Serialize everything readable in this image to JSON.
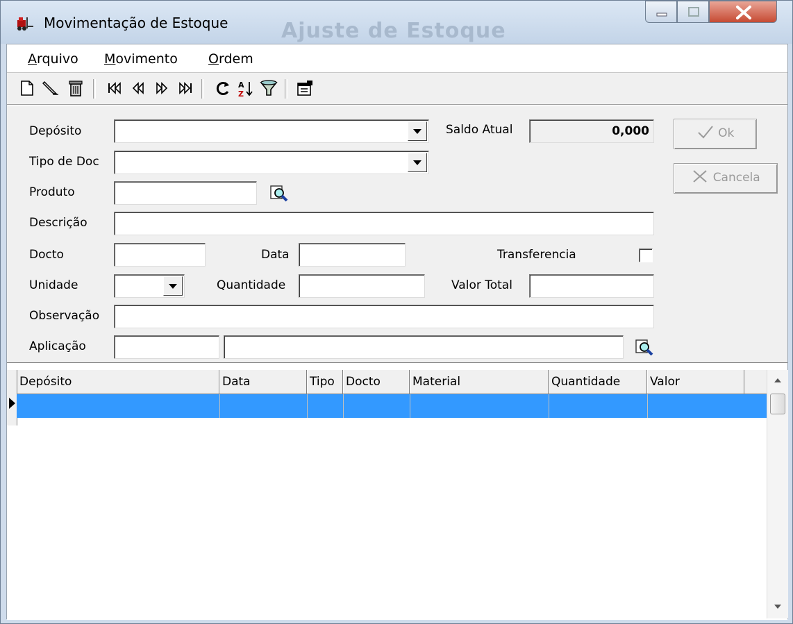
{
  "window": {
    "title": "Movimentação de Estoque",
    "ghost_title": "Ajuste de Estoque"
  },
  "menu": [
    {
      "label": "Arquivo",
      "accel": "A",
      "rest": "rquivo"
    },
    {
      "label": "Movimento",
      "accel": "M",
      "rest": "ovimento"
    },
    {
      "label": "Ordem",
      "accel": "O",
      "rest": "rdem"
    }
  ],
  "toolbar": {
    "icons": [
      "new-icon",
      "edit-icon",
      "delete-icon",
      "first-record-icon",
      "previous-record-icon",
      "next-record-icon",
      "last-record-icon",
      "refresh-icon",
      "sort-az-icon",
      "filter-icon",
      "properties-icon"
    ]
  },
  "form": {
    "deposito": {
      "label": "Depósito",
      "value": ""
    },
    "saldo_atual": {
      "label": "Saldo Atual",
      "value": "0,000"
    },
    "tipo_doc": {
      "label": "Tipo de Doc",
      "value": ""
    },
    "produto": {
      "label": "Produto",
      "value": ""
    },
    "descricao": {
      "label": "Descrição",
      "value": ""
    },
    "docto": {
      "label": "Docto",
      "value": ""
    },
    "data": {
      "label": "Data",
      "value": ""
    },
    "transferencia": {
      "label": "Transferencia",
      "checked": false
    },
    "unidade": {
      "label": "Unidade",
      "value": ""
    },
    "quantidade": {
      "label": "Quantidade",
      "value": ""
    },
    "valor_total": {
      "label": "Valor Total",
      "value": ""
    },
    "observacao": {
      "label": "Observação",
      "value": ""
    },
    "aplicacao": {
      "label": "Aplicação",
      "code": "",
      "description": ""
    },
    "ok_label": "Ok",
    "cancel_label": "Cancela"
  },
  "grid": {
    "columns": [
      "Depósito",
      "Data",
      "Tipo",
      "Docto",
      "Material",
      "Quantidade",
      "Valor"
    ],
    "rows": []
  },
  "colors": {
    "selection": "#3399ff",
    "window_frame": "#cfdcec",
    "close_button": "#c64a33"
  }
}
